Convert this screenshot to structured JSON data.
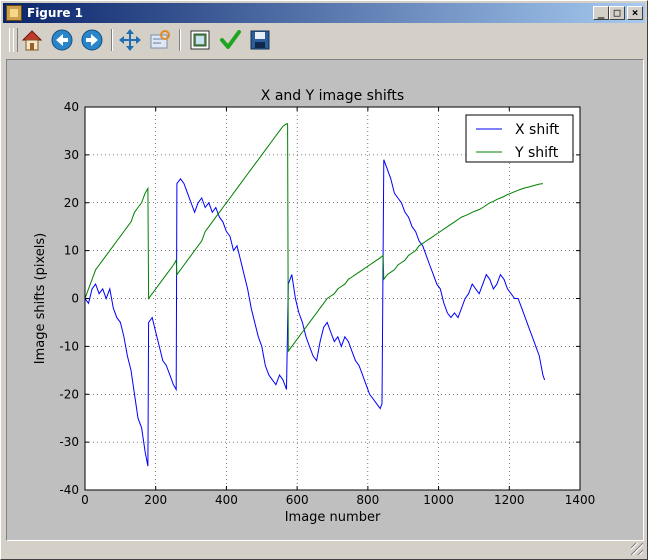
{
  "window": {
    "title": "Figure 1",
    "minimize_label": "_",
    "maximize_label": "□",
    "close_label": "×"
  },
  "toolbar": {
    "buttons": [
      {
        "name": "home",
        "icon": "home-icon"
      },
      {
        "name": "back",
        "icon": "back-arrow-icon"
      },
      {
        "name": "forward",
        "icon": "forward-arrow-icon"
      },
      {
        "name": "pan",
        "icon": "pan-icon"
      },
      {
        "name": "zoom",
        "icon": "zoom-icon"
      },
      {
        "name": "subplots",
        "icon": "subplots-icon"
      },
      {
        "name": "edit",
        "icon": "checkmark-icon"
      },
      {
        "name": "save",
        "icon": "save-icon"
      }
    ]
  },
  "chart_data": {
    "type": "line",
    "title": "X and Y image shifts",
    "xlabel": "Image number",
    "ylabel": "Image shifts (pixels)",
    "xlim": [
      0,
      1400
    ],
    "ylim": [
      -40,
      40
    ],
    "xticks": [
      0,
      200,
      400,
      600,
      800,
      1000,
      1200,
      1400
    ],
    "yticks": [
      -40,
      -30,
      -20,
      -10,
      0,
      10,
      20,
      30,
      40
    ],
    "grid": true,
    "legend_position": "top-right",
    "series": [
      {
        "name": "X shift",
        "color": "#0000ff",
        "points": [
          [
            0,
            0
          ],
          [
            10,
            -1
          ],
          [
            20,
            2
          ],
          [
            30,
            3
          ],
          [
            40,
            1
          ],
          [
            50,
            2
          ],
          [
            60,
            0
          ],
          [
            70,
            2
          ],
          [
            80,
            -2
          ],
          [
            90,
            -4
          ],
          [
            100,
            -5
          ],
          [
            110,
            -8
          ],
          [
            120,
            -12
          ],
          [
            130,
            -15
          ],
          [
            140,
            -20
          ],
          [
            150,
            -25
          ],
          [
            160,
            -27
          ],
          [
            170,
            -32
          ],
          [
            178,
            -35
          ],
          [
            180,
            -5
          ],
          [
            190,
            -4
          ],
          [
            200,
            -7
          ],
          [
            210,
            -10
          ],
          [
            220,
            -13
          ],
          [
            230,
            -14
          ],
          [
            240,
            -16
          ],
          [
            250,
            -18
          ],
          [
            258,
            -19
          ],
          [
            260,
            24
          ],
          [
            270,
            25
          ],
          [
            280,
            24
          ],
          [
            290,
            22
          ],
          [
            300,
            20
          ],
          [
            310,
            18
          ],
          [
            320,
            20
          ],
          [
            330,
            21
          ],
          [
            340,
            19
          ],
          [
            350,
            20
          ],
          [
            360,
            18
          ],
          [
            370,
            19
          ],
          [
            380,
            17
          ],
          [
            390,
            16
          ],
          [
            400,
            14
          ],
          [
            410,
            13
          ],
          [
            420,
            10
          ],
          [
            430,
            11
          ],
          [
            440,
            8
          ],
          [
            450,
            5
          ],
          [
            460,
            2
          ],
          [
            470,
            -2
          ],
          [
            480,
            -5
          ],
          [
            490,
            -8
          ],
          [
            500,
            -10
          ],
          [
            510,
            -14
          ],
          [
            520,
            -16
          ],
          [
            530,
            -17
          ],
          [
            540,
            -18
          ],
          [
            550,
            -16
          ],
          [
            560,
            -17
          ],
          [
            570,
            -19
          ],
          [
            575,
            3
          ],
          [
            585,
            5
          ],
          [
            595,
            0
          ],
          [
            605,
            -3
          ],
          [
            615,
            -5
          ],
          [
            625,
            -8
          ],
          [
            635,
            -10
          ],
          [
            645,
            -12
          ],
          [
            655,
            -13
          ],
          [
            665,
            -9
          ],
          [
            675,
            -6
          ],
          [
            685,
            -5
          ],
          [
            695,
            -7
          ],
          [
            705,
            -9
          ],
          [
            715,
            -8
          ],
          [
            725,
            -10
          ],
          [
            735,
            -8
          ],
          [
            745,
            -9
          ],
          [
            755,
            -11
          ],
          [
            765,
            -13
          ],
          [
            775,
            -14
          ],
          [
            785,
            -16
          ],
          [
            795,
            -18
          ],
          [
            805,
            -20
          ],
          [
            815,
            -21
          ],
          [
            825,
            -22
          ],
          [
            835,
            -23
          ],
          [
            840,
            -22
          ],
          [
            845,
            29
          ],
          [
            855,
            27
          ],
          [
            865,
            25
          ],
          [
            875,
            22
          ],
          [
            885,
            21
          ],
          [
            895,
            20
          ],
          [
            905,
            18
          ],
          [
            915,
            17
          ],
          [
            925,
            15
          ],
          [
            935,
            14
          ],
          [
            945,
            12
          ],
          [
            955,
            11
          ],
          [
            965,
            9
          ],
          [
            975,
            7
          ],
          [
            985,
            5
          ],
          [
            995,
            3
          ],
          [
            1005,
            2
          ],
          [
            1015,
            -1
          ],
          [
            1025,
            -3
          ],
          [
            1035,
            -4
          ],
          [
            1045,
            -3
          ],
          [
            1055,
            -4
          ],
          [
            1065,
            -2
          ],
          [
            1075,
            0
          ],
          [
            1085,
            1
          ],
          [
            1095,
            3
          ],
          [
            1105,
            2
          ],
          [
            1115,
            1
          ],
          [
            1125,
            3
          ],
          [
            1135,
            5
          ],
          [
            1145,
            4
          ],
          [
            1155,
            2
          ],
          [
            1165,
            3
          ],
          [
            1175,
            5
          ],
          [
            1185,
            4
          ],
          [
            1195,
            2
          ],
          [
            1205,
            1
          ],
          [
            1215,
            0
          ],
          [
            1225,
            0
          ],
          [
            1235,
            -2
          ],
          [
            1245,
            -4
          ],
          [
            1255,
            -6
          ],
          [
            1265,
            -8
          ],
          [
            1275,
            -10
          ],
          [
            1285,
            -12
          ],
          [
            1295,
            -16
          ],
          [
            1300,
            -17
          ]
        ]
      },
      {
        "name": "Y shift",
        "color": "#008000",
        "points": [
          [
            0,
            0
          ],
          [
            10,
            2
          ],
          [
            20,
            4
          ],
          [
            30,
            6
          ],
          [
            40,
            7
          ],
          [
            50,
            8
          ],
          [
            60,
            9
          ],
          [
            70,
            10
          ],
          [
            80,
            11
          ],
          [
            90,
            12
          ],
          [
            100,
            13
          ],
          [
            110,
            14
          ],
          [
            120,
            15
          ],
          [
            130,
            16
          ],
          [
            140,
            18
          ],
          [
            150,
            19
          ],
          [
            160,
            20
          ],
          [
            170,
            22
          ],
          [
            178,
            23
          ],
          [
            180,
            0
          ],
          [
            190,
            1
          ],
          [
            200,
            2
          ],
          [
            210,
            3
          ],
          [
            220,
            4
          ],
          [
            230,
            5
          ],
          [
            240,
            6
          ],
          [
            250,
            7
          ],
          [
            258,
            8
          ],
          [
            260,
            5
          ],
          [
            270,
            6
          ],
          [
            280,
            7
          ],
          [
            290,
            8
          ],
          [
            300,
            9
          ],
          [
            310,
            10
          ],
          [
            320,
            11
          ],
          [
            330,
            12
          ],
          [
            340,
            14
          ],
          [
            350,
            15
          ],
          [
            360,
            16
          ],
          [
            370,
            17
          ],
          [
            380,
            18
          ],
          [
            390,
            19
          ],
          [
            400,
            20
          ],
          [
            410,
            21
          ],
          [
            420,
            22
          ],
          [
            430,
            23
          ],
          [
            440,
            24
          ],
          [
            450,
            25
          ],
          [
            460,
            26
          ],
          [
            470,
            27
          ],
          [
            480,
            28
          ],
          [
            490,
            29
          ],
          [
            500,
            30
          ],
          [
            510,
            31
          ],
          [
            520,
            32
          ],
          [
            530,
            33
          ],
          [
            540,
            34
          ],
          [
            550,
            35
          ],
          [
            560,
            36
          ],
          [
            570,
            36.5
          ],
          [
            573,
            36.5
          ],
          [
            575,
            -11
          ],
          [
            585,
            -10
          ],
          [
            595,
            -9
          ],
          [
            605,
            -8
          ],
          [
            615,
            -7
          ],
          [
            625,
            -6
          ],
          [
            635,
            -5
          ],
          [
            645,
            -4
          ],
          [
            655,
            -3
          ],
          [
            665,
            -2
          ],
          [
            675,
            -1
          ],
          [
            685,
            0
          ],
          [
            695,
            0.5
          ],
          [
            705,
            1
          ],
          [
            715,
            2
          ],
          [
            725,
            2.5
          ],
          [
            735,
            3
          ],
          [
            745,
            4
          ],
          [
            755,
            4.5
          ],
          [
            765,
            5
          ],
          [
            775,
            5.5
          ],
          [
            785,
            6
          ],
          [
            795,
            6.5
          ],
          [
            805,
            7
          ],
          [
            815,
            7.5
          ],
          [
            825,
            8
          ],
          [
            835,
            8.5
          ],
          [
            843,
            9
          ],
          [
            845,
            4
          ],
          [
            855,
            5
          ],
          [
            865,
            5.5
          ],
          [
            875,
            6
          ],
          [
            885,
            7
          ],
          [
            895,
            7.5
          ],
          [
            905,
            8
          ],
          [
            915,
            9
          ],
          [
            925,
            9.5
          ],
          [
            935,
            10
          ],
          [
            945,
            11
          ],
          [
            955,
            11.5
          ],
          [
            965,
            12
          ],
          [
            975,
            12.5
          ],
          [
            985,
            13
          ],
          [
            995,
            13.5
          ],
          [
            1005,
            14
          ],
          [
            1015,
            14.5
          ],
          [
            1025,
            15
          ],
          [
            1035,
            15.5
          ],
          [
            1045,
            16
          ],
          [
            1055,
            16.5
          ],
          [
            1065,
            17
          ],
          [
            1075,
            17.3
          ],
          [
            1085,
            17.6
          ],
          [
            1095,
            18
          ],
          [
            1105,
            18.3
          ],
          [
            1115,
            18.6
          ],
          [
            1125,
            19
          ],
          [
            1135,
            19.5
          ],
          [
            1145,
            20
          ],
          [
            1155,
            20.3
          ],
          [
            1165,
            20.7
          ],
          [
            1175,
            21
          ],
          [
            1185,
            21.3
          ],
          [
            1195,
            21.7
          ],
          [
            1205,
            22
          ],
          [
            1215,
            22.3
          ],
          [
            1225,
            22.6
          ],
          [
            1235,
            22.9
          ],
          [
            1245,
            23.1
          ],
          [
            1255,
            23.3
          ],
          [
            1265,
            23.5
          ],
          [
            1275,
            23.7
          ],
          [
            1285,
            23.9
          ],
          [
            1295,
            24
          ]
        ]
      }
    ]
  }
}
